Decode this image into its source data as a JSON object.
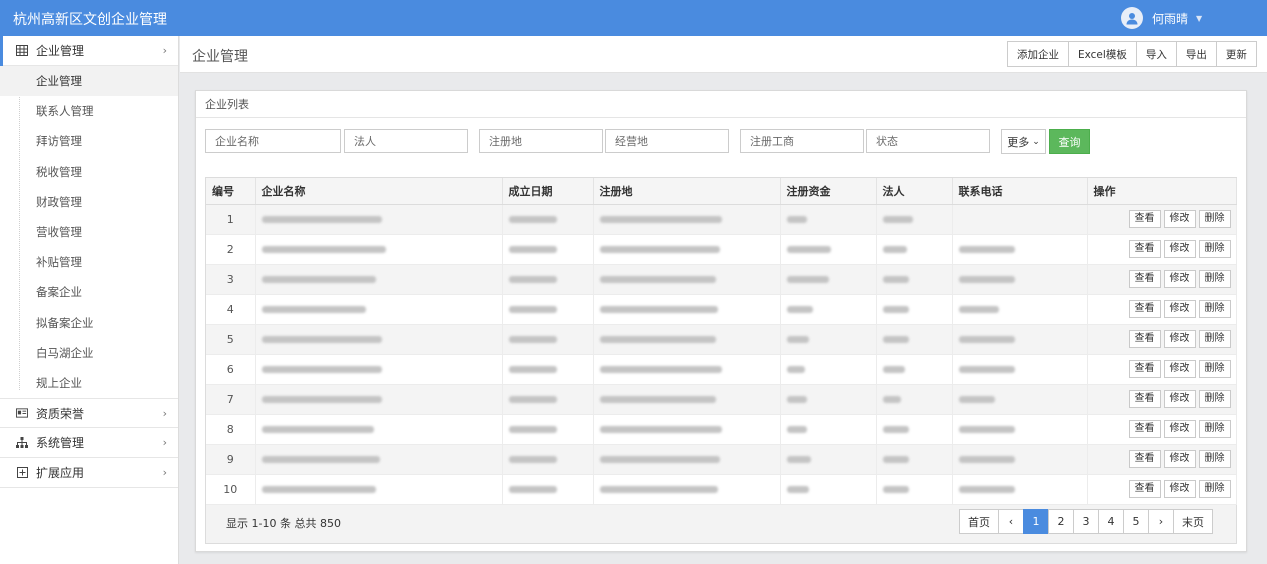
{
  "app": {
    "title": "杭州高新区文创企业管理"
  },
  "user": {
    "name": "何雨晴"
  },
  "sidebar": {
    "groups": [
      {
        "label": "企业管理",
        "icon": "grid-icon",
        "expanded": true,
        "items": [
          {
            "label": "企业管理",
            "active": true
          },
          {
            "label": "联系人管理"
          },
          {
            "label": "拜访管理"
          },
          {
            "label": "税收管理"
          },
          {
            "label": "财政管理"
          },
          {
            "label": "营收管理"
          },
          {
            "label": "补贴管理"
          },
          {
            "label": "备案企业"
          },
          {
            "label": "拟备案企业"
          },
          {
            "label": "白马湖企业"
          },
          {
            "label": "规上企业"
          }
        ]
      },
      {
        "label": "资质荣誉",
        "icon": "id-card-icon"
      },
      {
        "label": "系统管理",
        "icon": "sitemap-icon"
      },
      {
        "label": "扩展应用",
        "icon": "plus-square-icon"
      }
    ]
  },
  "page": {
    "title": "企业管理"
  },
  "toolbar": [
    "添加企业",
    "Excel模板",
    "导入",
    "导出",
    "更新"
  ],
  "panel": {
    "title": "企业列表"
  },
  "filters": {
    "company_name": "企业名称",
    "legal_person": "法人",
    "registered_address": "注册地",
    "business_address": "经营地",
    "registration_office": "注册工商",
    "status": "状态",
    "more": "更多",
    "query": "查询"
  },
  "table": {
    "columns": [
      "编号",
      "企业名称",
      "成立日期",
      "注册地",
      "注册资金",
      "法人",
      "联系电话",
      "操作"
    ],
    "row_numbers": [
      "1",
      "2",
      "3",
      "4",
      "5",
      "6",
      "7",
      "8",
      "9",
      "10"
    ],
    "actions": [
      "查看",
      "修改",
      "删除"
    ]
  },
  "summary": "显示 1-10 条 总共 850",
  "pagination": {
    "first": "首页",
    "prev": "‹",
    "pages": [
      "1",
      "2",
      "3",
      "4",
      "5"
    ],
    "current": "1",
    "next": "›",
    "last": "末页"
  },
  "colors": {
    "topbar": "#4a8bdf",
    "query_button": "#5cb85c",
    "active_page": "#4a8bdf"
  }
}
